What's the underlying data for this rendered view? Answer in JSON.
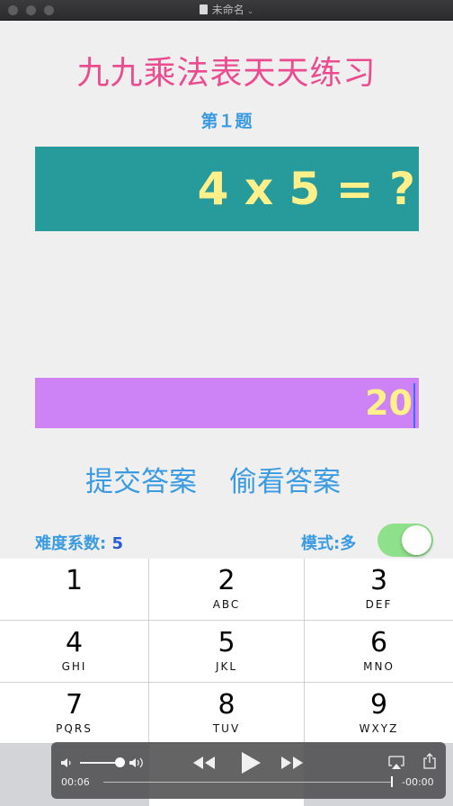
{
  "window": {
    "title": "未命名"
  },
  "app": {
    "title": "九九乘法表天天练习",
    "question_number": "第１题",
    "question": "4 x 5 = ?",
    "answer": "20",
    "submit_label": "提交答案",
    "peek_label": "偷看答案",
    "difficulty_label": "难度系数:",
    "difficulty_value": "5",
    "mode_label": "模式:多",
    "mode_toggle_on": true
  },
  "keypad": {
    "keys": [
      {
        "digit": "1",
        "letters": ""
      },
      {
        "digit": "2",
        "letters": "ABC"
      },
      {
        "digit": "3",
        "letters": "DEF"
      },
      {
        "digit": "4",
        "letters": "GHI"
      },
      {
        "digit": "5",
        "letters": "JKL"
      },
      {
        "digit": "6",
        "letters": "MNO"
      },
      {
        "digit": "7",
        "letters": "PQRS"
      },
      {
        "digit": "8",
        "letters": "TUV"
      },
      {
        "digit": "9",
        "letters": "WXYZ"
      }
    ]
  },
  "media": {
    "elapsed": "00:06",
    "remaining": "-00:00",
    "icons": [
      "speaker-low-icon",
      "speaker-high-icon",
      "rewind-icon",
      "play-icon",
      "fast-forward-icon",
      "airplay-icon",
      "share-icon"
    ]
  },
  "colors": {
    "title": "#ea4c8f",
    "accent": "#3b9be0",
    "question_bg": "#279b9c",
    "answer_bg": "#cd82f5",
    "digits": "#fff08a",
    "toggle_on": "#8fe08a"
  }
}
